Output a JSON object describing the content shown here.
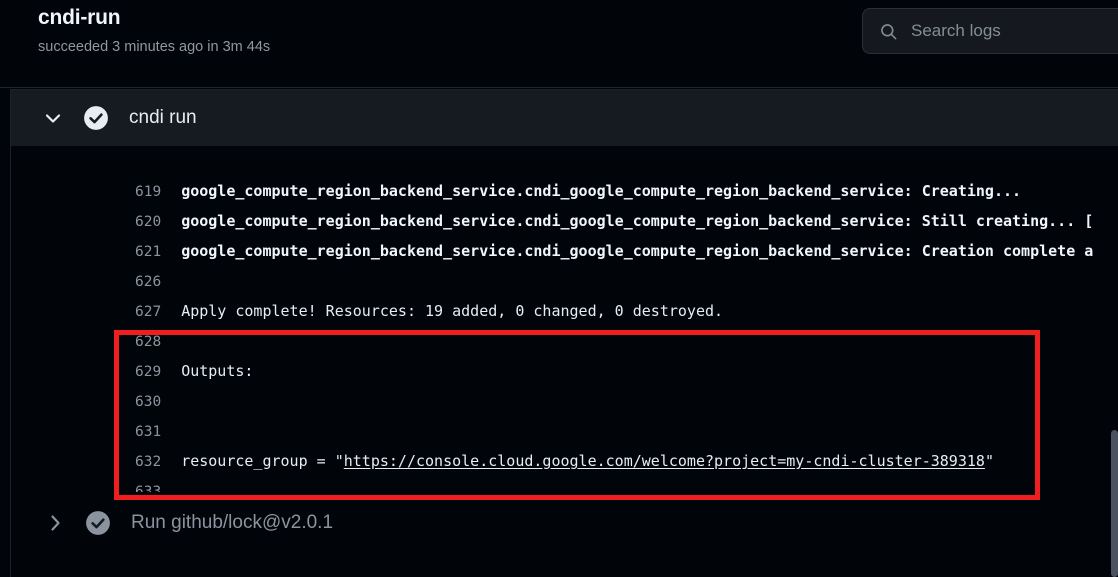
{
  "header": {
    "title": "cndi-run",
    "subtitle": "succeeded 3 minutes ago in 3m 44s"
  },
  "search": {
    "placeholder": "Search logs",
    "value": "",
    "icon": "search-icon"
  },
  "log_panel": {
    "active_group": {
      "label": "cndi run",
      "expanded": true,
      "status": "success",
      "chevron": "chevron-down-icon",
      "status_icon": "check-circle-icon"
    },
    "collapsed_group": {
      "label": "Run github/lock@v2.0.1",
      "expanded": false,
      "status": "success",
      "chevron": "chevron-right-icon",
      "status_icon": "check-circle-icon"
    },
    "lines": [
      {
        "number": "619",
        "text": "google_compute_region_backend_service.cndi_google_compute_region_backend_service: Creating...",
        "bold": true
      },
      {
        "number": "620",
        "text": "google_compute_region_backend_service.cndi_google_compute_region_backend_service: Still creating... [",
        "bold": true
      },
      {
        "number": "621",
        "text": "google_compute_region_backend_service.cndi_google_compute_region_backend_service: Creation complete a",
        "bold": true
      },
      {
        "number": "626",
        "text": "",
        "bold": false
      },
      {
        "number": "627",
        "text": "Apply complete! Resources: 19 added, 0 changed, 0 destroyed.",
        "bold": false
      },
      {
        "number": "628",
        "text": "",
        "bold": false
      },
      {
        "number": "629",
        "text": "Outputs:",
        "bold": false
      },
      {
        "number": "630",
        "text": "",
        "bold": false
      },
      {
        "number": "631",
        "text": "",
        "bold": false
      },
      {
        "number": "632",
        "bold": false,
        "prefix": "resource_group = \"",
        "link": "https://console.cloud.google.com/welcome?project=my-cndi-cluster-389318",
        "suffix": "\""
      },
      {
        "number": "633",
        "text": "",
        "bold": false
      }
    ]
  },
  "annotation": {
    "color": "#f01f1f",
    "label": "outputs-highlight"
  }
}
